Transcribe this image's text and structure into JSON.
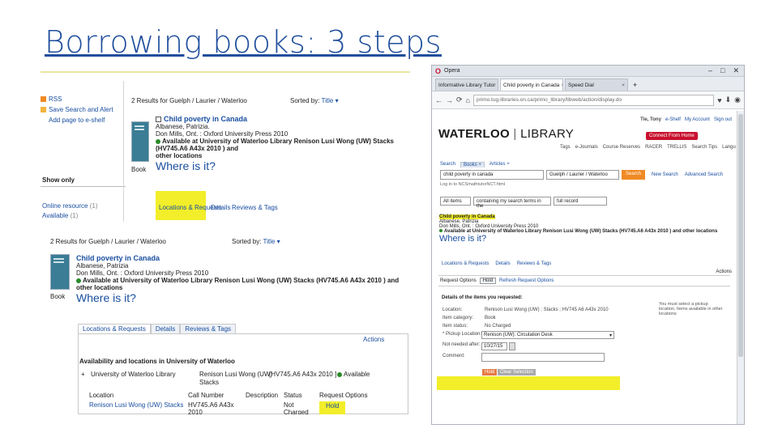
{
  "slide": {
    "title": "Borrowing books: 3 steps"
  },
  "shot1": {
    "sidebar": {
      "rss": "RSS",
      "save_search": "Save Search and Alert",
      "add_page": "Add page to e-shelf",
      "show_only": "Show only",
      "online_resource": "Online resource",
      "online_count": "(1)",
      "available": "Available",
      "available_count": "(1)"
    },
    "results_header": "2 Results for Guelph / Laurier / Waterloo",
    "sorted_by": "Sorted by:",
    "sort_value": "Title",
    "item": {
      "title": "Child poverty in Canada",
      "author": "Albanese, Patrizia.",
      "publisher": "Don Mills, Ont. : Oxford University Press 2010",
      "availability": "Available at University of Waterloo Library Renison Lusi Wong (UW) Stacks (HV745.A6 A43x 2010 ) and",
      "availability2": "other locations",
      "type": "Book",
      "where": "Where is it?"
    },
    "tabs": {
      "locations": "Locations & Requests",
      "details": "Details",
      "reviews": "Reviews & Tags"
    }
  },
  "shot2": {
    "results_header": "2 Results for Guelph / Laurier / Waterloo",
    "sorted_by": "Sorted by:",
    "sort_value": "Title",
    "item": {
      "title": "Child poverty in Canada",
      "author": "Albanese, Patrizia",
      "publisher": "Don Mills, Ont. : Oxford University Press 2010",
      "availability": "Available at University of Waterloo Library Renison Lusi Wong (UW) Stacks (HV745.A6 A43x 2010 ) and",
      "availability2": "other locations",
      "type": "Book",
      "where": "Where is it?"
    },
    "tabs": {
      "locations": "Locations & Requests",
      "details": "Details",
      "reviews": "Reviews & Tags"
    },
    "actions": "Actions",
    "avail_heading": "Availability and locations in University of Waterloo",
    "avail_row": {
      "lib": "University of Waterloo Library",
      "loc": "Renison Lusi Wong (UW)",
      "loc2": "Stacks",
      "call": "[HV745.A6 A43x 2010 ]",
      "status": "Available"
    },
    "columns": {
      "location": "Location",
      "call_number": "Call Number",
      "description": "Description",
      "status": "Status",
      "request_options": "Request Options"
    },
    "row": {
      "location": "Renison Lusi Wong (UW) Stacks",
      "call": "HV745.A6 A43x 2010",
      "status": "Not Charged",
      "request": "Hold"
    }
  },
  "browser": {
    "app": "Opera",
    "tabs": [
      {
        "label": "Informative Library Tutor"
      },
      {
        "label": "Child poverty in Canada"
      },
      {
        "label": "Speed Dial"
      }
    ],
    "url": "primo.tug-libraries.on.ca/primo_library/libweb/action/display.do",
    "util": {
      "user": "Tie, Tony",
      "eshelf": "e-Shelf",
      "account": "My Account",
      "signout": "Sign out"
    },
    "logo_main": "WATERLOO",
    "logo_sep": "|",
    "logo_lib": "LIBRARY",
    "connect": "Connect From Home",
    "nav": [
      "Tags",
      "e-Journals",
      "Course Reserves",
      "RACER",
      "TRELLIS",
      "Search Tips",
      "Langu"
    ],
    "search_tabs": {
      "search": "Search",
      "books": "Books +",
      "articles": "Articles +"
    },
    "search_value": "child poverty in canada",
    "scope": "Guelph / Laurier / Waterloo",
    "search_btn": "Search",
    "new_search": "New Search",
    "advanced": "Advanced Search",
    "login_note": "Log in to NCSmathtutorNCT.html",
    "filter_all": "All items",
    "filter_contains": "containing my search terms in the",
    "filter_field": "full record",
    "item": {
      "title": "Child poverty in Canada",
      "author": "Albanese, Patrizia",
      "publisher": "Don Mills, Ont. : Oxford University Press 2010",
      "availability": "Available at University of Waterloo Library Renison Lusi Wong (UW) Stacks (HV745.A6 A43x 2010 ) and other locations",
      "where": "Where is it?"
    },
    "tabs2": {
      "locations": "Locations & Requests",
      "details": "Details",
      "reviews": "Reviews & Tags"
    },
    "actions": "Actions",
    "req_tabs": {
      "options": "Request Options",
      "hold": "Hold",
      "refresh": "Refresh Request Options"
    },
    "details_heading": "Details of the items you requested:",
    "fields": [
      {
        "label": "Location:",
        "value": "Renison Lusi Wong (UW) ; Stacks ; HV745 A6 A43x 2010"
      },
      {
        "label": "Item category:",
        "value": "Book"
      },
      {
        "label": "Item status:",
        "value": "No Charged"
      },
      {
        "label": "* Pickup Location:",
        "value": "Renison (UW): Circulation Desk"
      },
      {
        "label": "Not needed after:",
        "value": "10/27/15"
      },
      {
        "label": "Comment:",
        "value": ""
      }
    ],
    "note": "You must select a pickup location. Items available in other locations",
    "hold_btn": "Hold",
    "clear_btn": "Clear Selection"
  }
}
